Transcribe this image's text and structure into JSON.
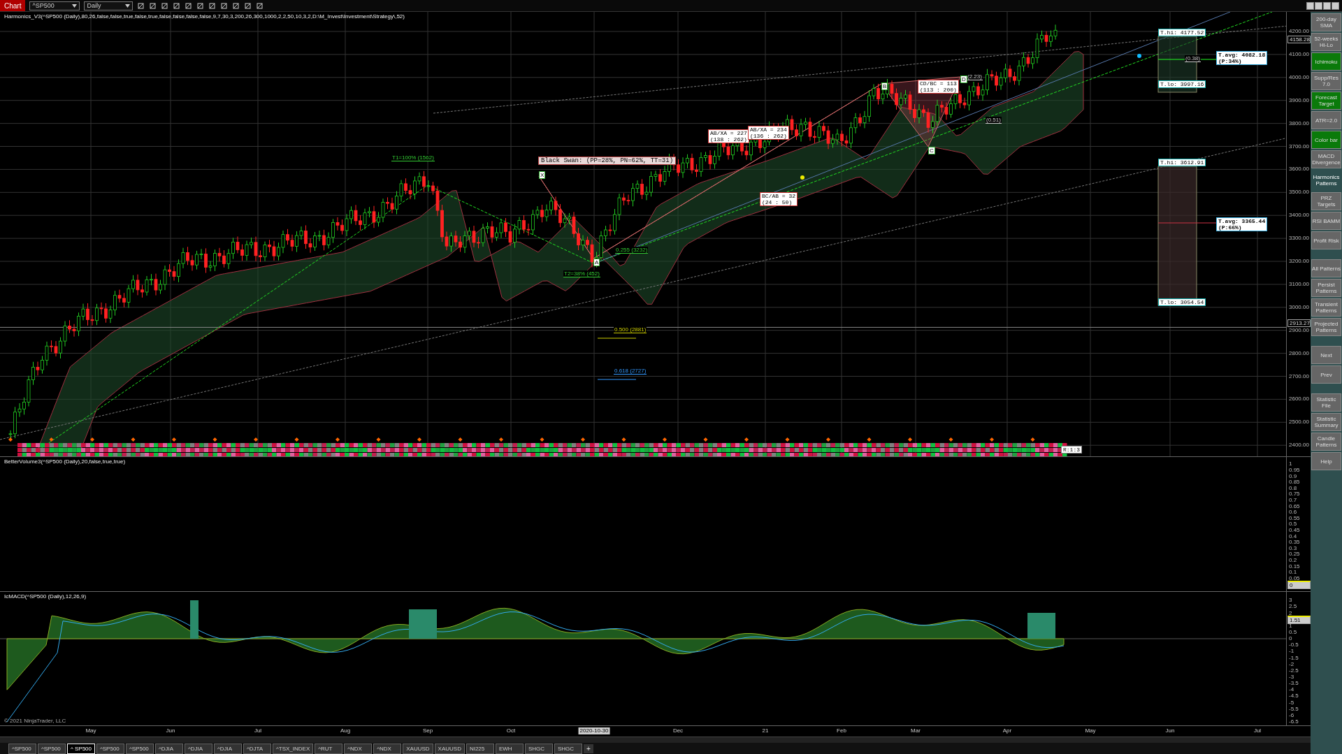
{
  "top_bar": {
    "title": "Chart",
    "instrument": "^SP500",
    "period": "Daily"
  },
  "main_panel": {
    "indicator": "Harmonics_V3(^SP500 (Daily),80,26,false,false,true,false,true,false,false,false,false,9,7,30,3,200,26,300,1000,2,2,50,10,3,2,D:\\M_Invest\\Investment\\Strategy\\,52)",
    "price_ticks": [
      "4200.00",
      "4100.00",
      "4000.00",
      "3900.00",
      "3800.00",
      "3700.00",
      "3600.00",
      "3500.00",
      "3400.00",
      "3300.00",
      "3200.00",
      "3100.00",
      "3000.00",
      "2900.00",
      "2800.00",
      "2700.00",
      "2600.00",
      "2500.00",
      "2400.00"
    ],
    "price_tags": [
      "4158.28",
      "2913.27"
    ],
    "pattern_title": "Black Swan: (PP=28%, PN=62%, TT=31)",
    "ratio_boxes": [
      {
        "lines": [
          "AB/XA = 227",
          "(138 : 262)"
        ]
      },
      {
        "lines": [
          "AB/XA = 234",
          "(136 : 262)"
        ]
      },
      {
        "lines": [
          "CD/BC = 113",
          "(113 : 200)"
        ]
      },
      {
        "lines": [
          "BC/AB = 32",
          "(24 : 50)"
        ]
      }
    ],
    "target_boxes": [
      {
        "lines": [
          "T.hi: 4177.52"
        ],
        "kind": "edge"
      },
      {
        "lines": [
          "T.avg: 4082.18",
          "(P:34%)"
        ],
        "kind": "avg"
      },
      {
        "lines": [
          "T.lo: 3997.16"
        ],
        "kind": "edge"
      },
      {
        "lines": [
          "T.hi: 3612.91"
        ],
        "kind": "edge"
      },
      {
        "lines": [
          "T.avg: 3365.44",
          "(P:66%)"
        ],
        "kind": "avg"
      },
      {
        "lines": [
          "T.lo: 3054.54"
        ],
        "kind": "edge"
      }
    ],
    "level_labels": [
      {
        "text": "0.255 (3232)",
        "color": "#33cc33"
      },
      {
        "text": "0.500 (2881)",
        "color": "#cccc00"
      },
      {
        "text": "0.618 (2727)",
        "color": "#3399ff"
      },
      {
        "text": "T1=100% (1562)",
        "color": "#33cc33"
      },
      {
        "text": "T2=38% (452)",
        "color": "#33cc33"
      },
      {
        "text": "(2.23)",
        "color": "#cccccc"
      },
      {
        "text": "(0.51)",
        "color": "#cccccc"
      },
      {
        "text": "(0.38)",
        "color": "#cccccc"
      }
    ],
    "points": [
      "X",
      "A",
      "B",
      "C",
      "D"
    ],
    "corner_tag": "R:1:3"
  },
  "volume_panel": {
    "indicator": "BetterVolume3(^SP500 (Daily),20,false,true,true)",
    "ticks": [
      "1",
      "0.95",
      "0.9",
      "0.85",
      "0.8",
      "0.75",
      "0.7",
      "0.65",
      "0.6",
      "0.55",
      "0.5",
      "0.45",
      "0.4",
      "0.35",
      "0.3",
      "0.25",
      "0.2",
      "0.15",
      "0.1",
      "0.05"
    ],
    "tag": "0"
  },
  "macd_panel": {
    "indicator": "IcMACD(^SP500 (Daily),12,26,9)",
    "ticks": [
      "3",
      "2.5",
      "2",
      "1",
      "0.5",
      "0",
      "-0.5",
      "-1",
      "-1.5",
      "-2",
      "-2.5",
      "-3",
      "-3.5",
      "-4",
      "-4.5",
      "-5",
      "-5.5",
      "-6",
      "-6.5"
    ],
    "tag": "1.51",
    "copyright": "© 2021 NinjaTrader, LLC"
  },
  "x_axis": [
    {
      "label": "May",
      "selected": false
    },
    {
      "label": "Jun",
      "selected": false
    },
    {
      "label": "Jul",
      "selected": false
    },
    {
      "label": "Aug",
      "selected": false
    },
    {
      "label": "Sep",
      "selected": false
    },
    {
      "label": "Oct",
      "selected": false
    },
    {
      "label": "2020-10-30",
      "selected": true
    },
    {
      "label": "Dec",
      "selected": false
    },
    {
      "label": "21",
      "selected": false
    },
    {
      "label": "Feb",
      "selected": false
    },
    {
      "label": "Mar",
      "selected": false
    },
    {
      "label": "Apr",
      "selected": false
    },
    {
      "label": "May",
      "selected": false
    },
    {
      "label": "Jun",
      "selected": false
    },
    {
      "label": "Jul",
      "selected": false
    }
  ],
  "sidebar": [
    {
      "kind": "button",
      "label": "200-day SMA",
      "on": false
    },
    {
      "kind": "button",
      "label": "52-weeks Hi-Lo",
      "on": false
    },
    {
      "kind": "button",
      "label": "Ichimoku",
      "on": true
    },
    {
      "kind": "button",
      "label": "Supp/Res 7.0",
      "on": false
    },
    {
      "kind": "button",
      "label": "Forecast Target",
      "on": true
    },
    {
      "kind": "button",
      "label": "ATR=2.0",
      "on": false
    },
    {
      "kind": "button",
      "label": "Color bar",
      "on": true
    },
    {
      "kind": "button",
      "label": "MACD Divergence",
      "on": false
    },
    {
      "kind": "header",
      "label": "Harmonics Patterns"
    },
    {
      "kind": "button",
      "label": "PRZ Targets",
      "on": false
    },
    {
      "kind": "button",
      "label": "RSI BAMM",
      "on": false
    },
    {
      "kind": "button",
      "label": "Profit Risk",
      "on": false
    },
    {
      "kind": "spacer"
    },
    {
      "kind": "button",
      "label": "All Patterns",
      "on": false
    },
    {
      "kind": "button",
      "label": "Persist Patterns",
      "on": false
    },
    {
      "kind": "button",
      "label": "Transient Patterns",
      "on": false
    },
    {
      "kind": "button",
      "label": "Projected Patterns",
      "on": false
    },
    {
      "kind": "spacer"
    },
    {
      "kind": "button",
      "label": "Next",
      "on": false
    },
    {
      "kind": "button",
      "label": "Prev",
      "on": false
    },
    {
      "kind": "spacer"
    },
    {
      "kind": "button",
      "label": "Statistic File",
      "on": false
    },
    {
      "kind": "button",
      "label": "Statistic Summary",
      "on": false
    },
    {
      "kind": "button",
      "label": "Candle Patterns",
      "on": false
    },
    {
      "kind": "button",
      "label": "Help",
      "on": false
    }
  ],
  "tabs": [
    {
      "label": "^SP500",
      "selected": false
    },
    {
      "label": "^SP500",
      "selected": false
    },
    {
      "label": "^ SP500",
      "selected": true
    },
    {
      "label": "^SP500",
      "selected": false
    },
    {
      "label": "^SP500",
      "selected": false
    },
    {
      "label": "^DJIA",
      "selected": false
    },
    {
      "label": "^DJIA",
      "selected": false
    },
    {
      "label": "^DJIA",
      "selected": false
    },
    {
      "label": "^DJTA",
      "selected": false
    },
    {
      "label": "^TSX_INDEX",
      "selected": false
    },
    {
      "label": "^RUT",
      "selected": false
    },
    {
      "label": "^NDX",
      "selected": false
    },
    {
      "label": "^NDX",
      "selected": false
    },
    {
      "label": "XAUUSD",
      "selected": false
    },
    {
      "label": "XAUUSD",
      "selected": false
    },
    {
      "label": "NI225",
      "selected": false
    },
    {
      "label": "EWH",
      "selected": false
    },
    {
      "label": "SHGC",
      "selected": false
    },
    {
      "label": "SHGC",
      "selected": false
    }
  ],
  "add_tab": "+"
}
